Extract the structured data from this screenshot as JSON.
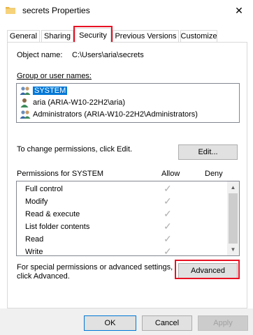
{
  "window": {
    "title": "secrets Properties",
    "close_glyph": "✕",
    "folder_icon": "folder-icon"
  },
  "tabs": [
    {
      "label": "General"
    },
    {
      "label": "Sharing"
    },
    {
      "label": "Security"
    },
    {
      "label": "Previous Versions"
    },
    {
      "label": "Customize"
    }
  ],
  "security": {
    "object_name_label": "Object name:",
    "object_name_value": "C:\\Users\\aria\\secrets",
    "group_label": "Group or user names:",
    "groups": [
      {
        "name": "SYSTEM",
        "icon": "users-group-icon"
      },
      {
        "name": "aria (ARIA-W10-22H2\\aria)",
        "icon": "user-icon"
      },
      {
        "name": "Administrators (ARIA-W10-22H2\\Administrators)",
        "icon": "users-group-icon"
      }
    ],
    "change_perm_text": "To change permissions, click Edit.",
    "edit_button": "Edit...",
    "permissions_label": "Permissions for SYSTEM",
    "allow_header": "Allow",
    "deny_header": "Deny",
    "permissions": [
      {
        "name": "Full control"
      },
      {
        "name": "Modify"
      },
      {
        "name": "Read & execute"
      },
      {
        "name": "List folder contents"
      },
      {
        "name": "Read"
      },
      {
        "name": "Write"
      }
    ],
    "check_glyph": "✓",
    "special_text_1": "For special permissions or advanced settings,",
    "special_text_2": "click Advanced.",
    "advanced_button": "Advanced"
  },
  "buttons": {
    "ok": "OK",
    "cancel": "Cancel",
    "apply": "Apply"
  },
  "colors": {
    "selection": "#0078d7",
    "highlight": "#e81123"
  }
}
